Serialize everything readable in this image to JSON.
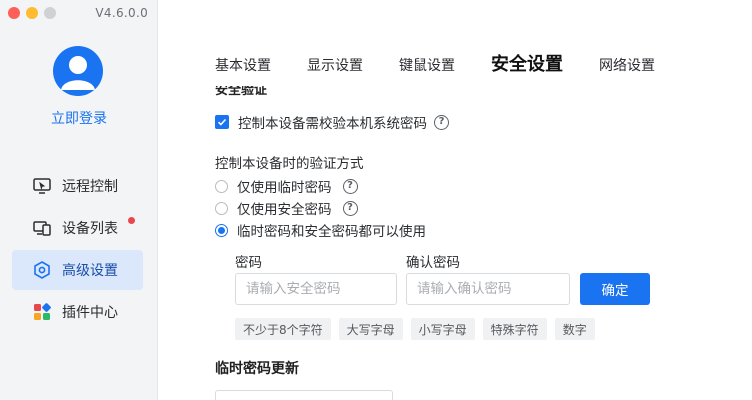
{
  "window": {
    "version": "V4.6.0.0"
  },
  "sidebar": {
    "login_label": "立即登录",
    "items": [
      {
        "label": "远程控制",
        "icon": "remote-control-icon",
        "active": false,
        "badge": false
      },
      {
        "label": "设备列表",
        "icon": "device-list-icon",
        "active": false,
        "badge": true
      },
      {
        "label": "高级设置",
        "icon": "advanced-settings-icon",
        "active": true,
        "badge": false
      },
      {
        "label": "插件中心",
        "icon": "plugin-center-icon",
        "active": false,
        "badge": false
      }
    ]
  },
  "tabs": [
    {
      "label": "基本设置",
      "active": false
    },
    {
      "label": "显示设置",
      "active": false
    },
    {
      "label": "键鼠设置",
      "active": false
    },
    {
      "label": "安全设置",
      "active": true
    },
    {
      "label": "网络设置",
      "active": false
    }
  ],
  "security": {
    "section_title": "安全验证",
    "require_local_password": {
      "label": "控制本设备需校验本机系统密码",
      "checked": true
    },
    "verify_method_label": "控制本设备时的验证方式",
    "verify_options": [
      {
        "label": "仅使用临时密码",
        "checked": false,
        "help": true
      },
      {
        "label": "仅使用安全密码",
        "checked": false,
        "help": true
      },
      {
        "label": "临时密码和安全密码都可以使用",
        "checked": true,
        "help": false
      }
    ],
    "password_label": "密码",
    "password_placeholder": "请输入安全密码",
    "confirm_label": "确认密码",
    "confirm_placeholder": "请输入确认密码",
    "confirm_button": "确定",
    "rules": [
      "不少于8个字符",
      "大写字母",
      "小写字母",
      "特殊字符",
      "数字"
    ],
    "temp_password_update_title": "临时密码更新"
  },
  "colors": {
    "accent": "#1a73f0",
    "sidebar_bg": "#f3f4f6",
    "active_nav_bg": "#dbe7fb",
    "badge": "#e8484d"
  }
}
